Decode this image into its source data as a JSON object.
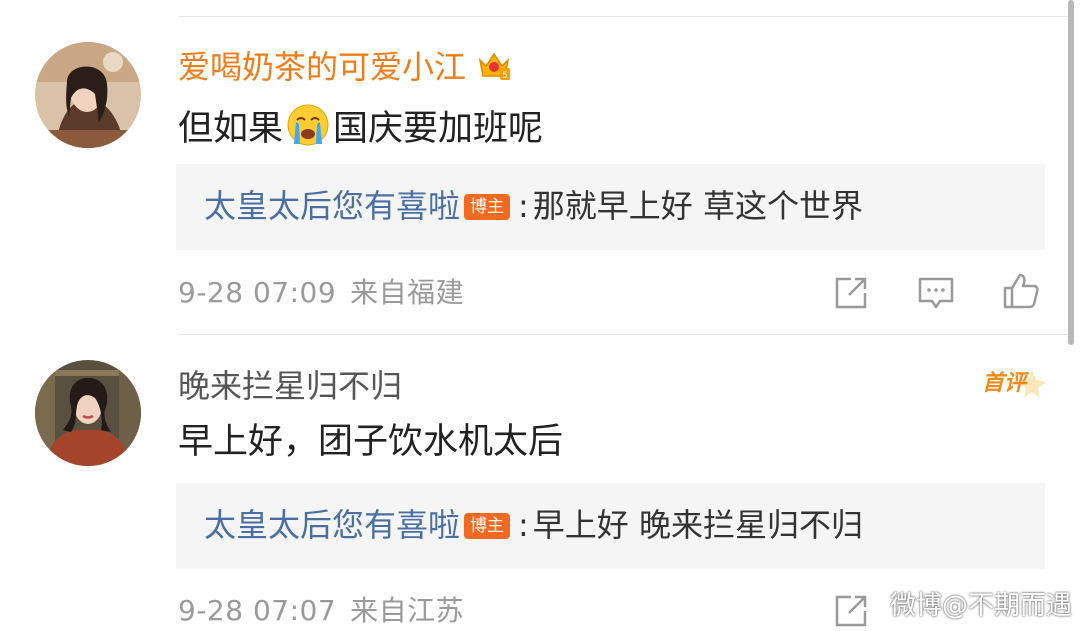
{
  "comments": [
    {
      "username": "爱喝奶茶的可爱小江",
      "content_before_emoji": "但如果",
      "emoji": "crying-face",
      "content_after_emoji": "国庆要加班呢",
      "reply": {
        "author": "太皇太后您有喜啦",
        "badge": "博主",
        "colon": ":",
        "text": "那就早上好 草这个世界"
      },
      "date": "9-28 07:09",
      "location": "来自福建"
    },
    {
      "username": "晚来拦星归不归",
      "badge_label": "首评",
      "content": "早上好，团子饮水机太后",
      "reply": {
        "author": "太皇太后您有喜啦",
        "badge": "博主",
        "colon": ":",
        "text": "早上好 晚来拦星归不归"
      },
      "date": "9-28 07:07",
      "location": "来自江苏"
    }
  ],
  "watermark": "微博@不期而遇",
  "colors": {
    "vip_username": "#f07c18",
    "reply_author": "#4a6fa3",
    "badge_bg": "#f26a22",
    "meta_text": "#9a9a9a",
    "reply_bg": "#f5f5f5"
  },
  "icons": [
    "crown-icon",
    "crying-face-emoji",
    "share-icon",
    "comment-icon",
    "like-icon",
    "first-comment-badge"
  ]
}
